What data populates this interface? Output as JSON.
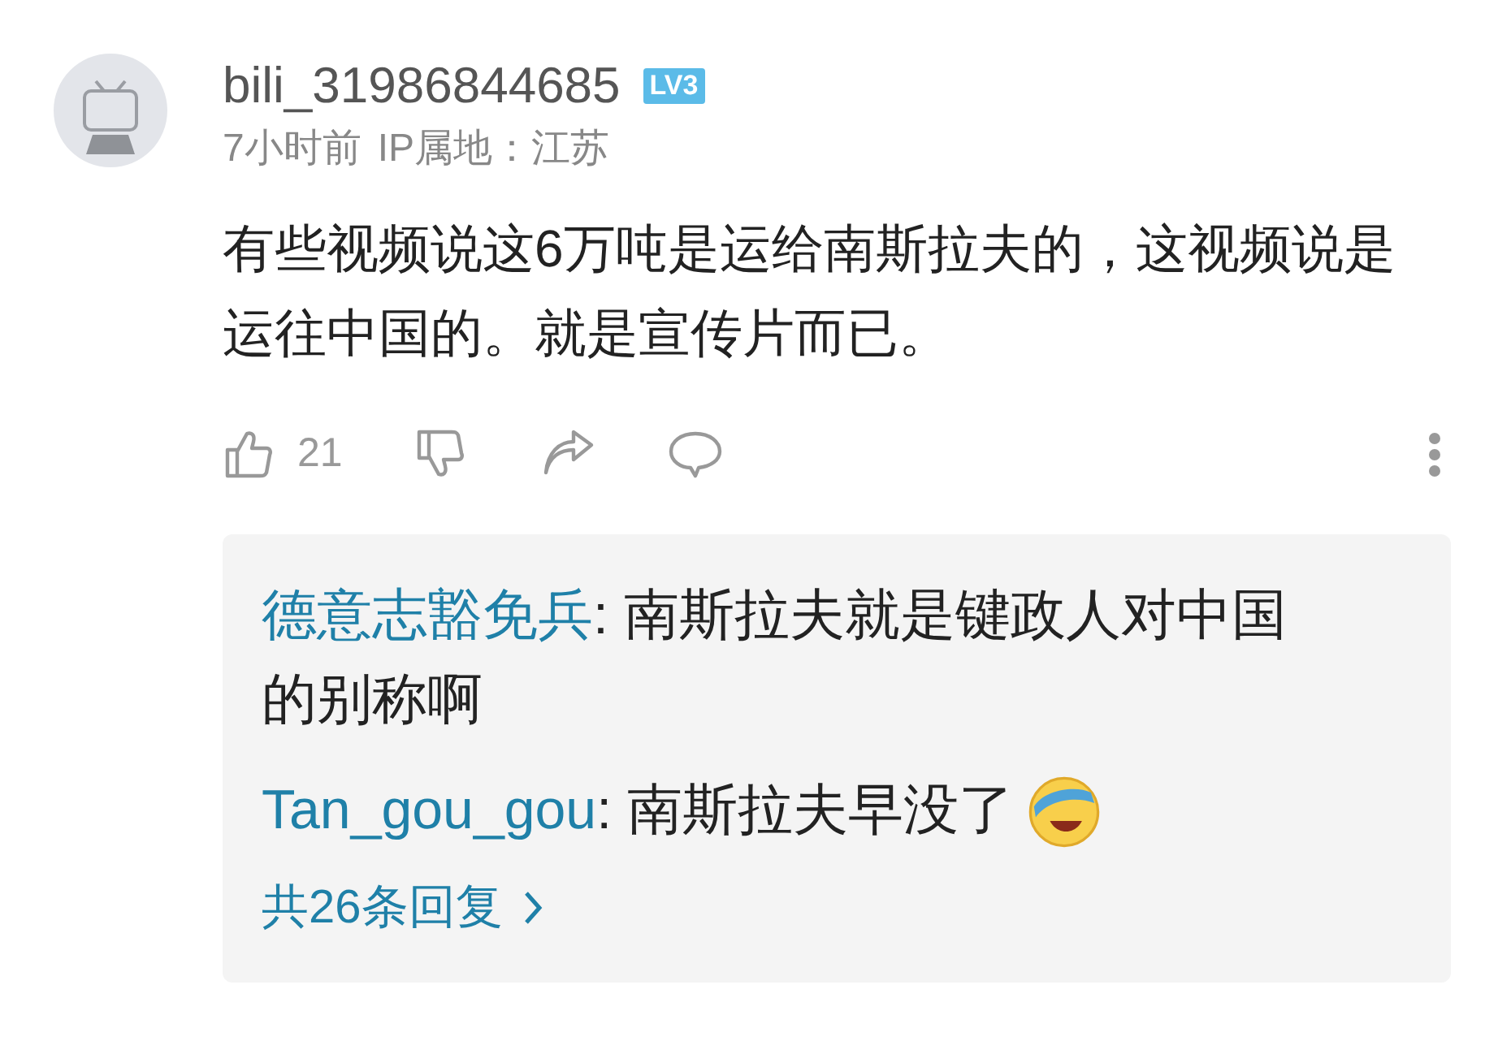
{
  "comment": {
    "username": "bili_31986844685",
    "level_badge": "LV3",
    "time": "7小时前",
    "ip_location": "IP属地：江苏",
    "text": "有些视频说这6万吨是运给南斯拉夫的，这视频说是运往中国的。就是宣传片而已。",
    "actions": [
      {
        "kind": "like",
        "count": "21"
      },
      {
        "kind": "dislike"
      },
      {
        "kind": "share"
      },
      {
        "kind": "comment"
      }
    ],
    "replies": [
      {
        "author": "德意志豁免兵",
        "text": ": 南斯拉夫就是键政人对中国的别称啊",
        "emoji": false
      },
      {
        "author": "Tan_gou_gou",
        "text": ": 南斯拉夫早没了",
        "emoji": true
      }
    ],
    "more_replies": "共26条回复"
  }
}
